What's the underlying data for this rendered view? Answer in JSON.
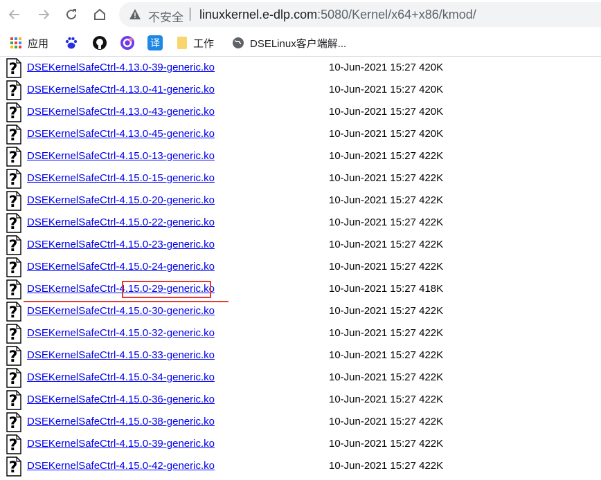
{
  "browser": {
    "security_label": "不安全",
    "separator": "|",
    "url_host": "linuxkernel.e-dlp.com",
    "url_rest": ":5080/Kernel/x64+x86/kmod/"
  },
  "bookmarks": [
    {
      "label": "应用",
      "icon": "apps-grid-icon"
    },
    {
      "label": "",
      "icon": "baidu-paw-icon"
    },
    {
      "label": "",
      "icon": "github-icon"
    },
    {
      "label": "",
      "icon": "purple-circle-icon"
    },
    {
      "label": "",
      "icon": "translate-icon"
    },
    {
      "label": "工作",
      "icon": "folder-icon"
    },
    {
      "label": "DSELinux客户端解...",
      "icon": "globe-icon"
    }
  ],
  "files": [
    {
      "name": "DSEKernelSafeCtrl-4.13.0-39-generic.ko",
      "date": "10-Jun-2021 15:27",
      "size": "420K"
    },
    {
      "name": "DSEKernelSafeCtrl-4.13.0-41-generic.ko",
      "date": "10-Jun-2021 15:27",
      "size": "420K"
    },
    {
      "name": "DSEKernelSafeCtrl-4.13.0-43-generic.ko",
      "date": "10-Jun-2021 15:27",
      "size": "420K"
    },
    {
      "name": "DSEKernelSafeCtrl-4.13.0-45-generic.ko",
      "date": "10-Jun-2021 15:27",
      "size": "420K"
    },
    {
      "name": "DSEKernelSafeCtrl-4.15.0-13-generic.ko",
      "date": "10-Jun-2021 15:27",
      "size": "422K"
    },
    {
      "name": "DSEKernelSafeCtrl-4.15.0-15-generic.ko",
      "date": "10-Jun-2021 15:27",
      "size": "422K"
    },
    {
      "name": "DSEKernelSafeCtrl-4.15.0-20-generic.ko",
      "date": "10-Jun-2021 15:27",
      "size": "422K"
    },
    {
      "name": "DSEKernelSafeCtrl-4.15.0-22-generic.ko",
      "date": "10-Jun-2021 15:27",
      "size": "422K"
    },
    {
      "name": "DSEKernelSafeCtrl-4.15.0-23-generic.ko",
      "date": "10-Jun-2021 15:27",
      "size": "422K"
    },
    {
      "name": "DSEKernelSafeCtrl-4.15.0-24-generic.ko",
      "date": "10-Jun-2021 15:27",
      "size": "422K"
    },
    {
      "name": "DSEKernelSafeCtrl-4.15.0-29-generic.ko",
      "date": "10-Jun-2021 15:27",
      "size": "418K"
    },
    {
      "name": "DSEKernelSafeCtrl-4.15.0-30-generic.ko",
      "date": "10-Jun-2021 15:27",
      "size": "422K"
    },
    {
      "name": "DSEKernelSafeCtrl-4.15.0-32-generic.ko",
      "date": "10-Jun-2021 15:27",
      "size": "422K"
    },
    {
      "name": "DSEKernelSafeCtrl-4.15.0-33-generic.ko",
      "date": "10-Jun-2021 15:27",
      "size": "422K"
    },
    {
      "name": "DSEKernelSafeCtrl-4.15.0-34-generic.ko",
      "date": "10-Jun-2021 15:27",
      "size": "422K"
    },
    {
      "name": "DSEKernelSafeCtrl-4.15.0-36-generic.ko",
      "date": "10-Jun-2021 15:27",
      "size": "422K"
    },
    {
      "name": "DSEKernelSafeCtrl-4.15.0-38-generic.ko",
      "date": "10-Jun-2021 15:27",
      "size": "422K"
    },
    {
      "name": "DSEKernelSafeCtrl-4.15.0-39-generic.ko",
      "date": "10-Jun-2021 15:27",
      "size": "422K"
    },
    {
      "name": "DSEKernelSafeCtrl-4.15.0-42-generic.ko",
      "date": "10-Jun-2021 15:27",
      "size": "422K"
    }
  ],
  "colors": {
    "link": "#0000ee",
    "annotation": "#e53935"
  }
}
